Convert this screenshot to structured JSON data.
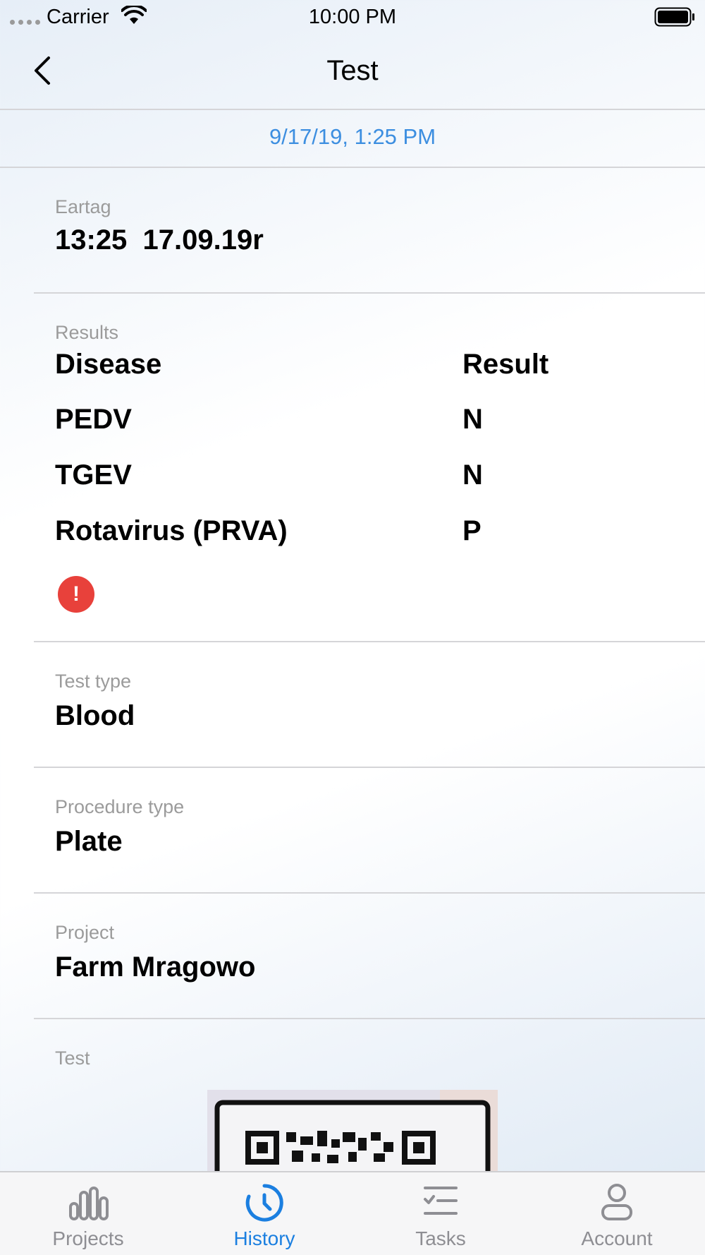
{
  "status_bar": {
    "carrier": "Carrier",
    "time": "10:00 PM"
  },
  "nav": {
    "title": "Test"
  },
  "date_header": "9/17/19, 1:25 PM",
  "eartag": {
    "label": "Eartag",
    "value": "13:25  17.09.19r"
  },
  "results": {
    "label": "Results",
    "header": {
      "disease": "Disease",
      "result": "Result"
    },
    "rows": [
      {
        "disease": "PEDV",
        "result": "N"
      },
      {
        "disease": "TGEV",
        "result": "N"
      },
      {
        "disease": "Rotavirus (PRVA)",
        "result": "P"
      }
    ],
    "alert_icon": "!"
  },
  "test_type": {
    "label": "Test type",
    "value": "Blood"
  },
  "procedure_type": {
    "label": "Procedure type",
    "value": "Plate"
  },
  "project": {
    "label": "Project",
    "value": "Farm Mragowo"
  },
  "test": {
    "label": "Test"
  },
  "tabs": [
    {
      "label": "Projects",
      "icon": "bar-chart-icon",
      "active": false
    },
    {
      "label": "History",
      "icon": "clock-icon",
      "active": true
    },
    {
      "label": "Tasks",
      "icon": "checklist-icon",
      "active": false
    },
    {
      "label": "Account",
      "icon": "person-icon",
      "active": false
    }
  ],
  "colors": {
    "accent": "#1b7fe0",
    "date_text": "#3c8ee0",
    "alert": "#e8413b",
    "label_gray": "#9b9b9b",
    "tab_inactive": "#8e8e93"
  }
}
